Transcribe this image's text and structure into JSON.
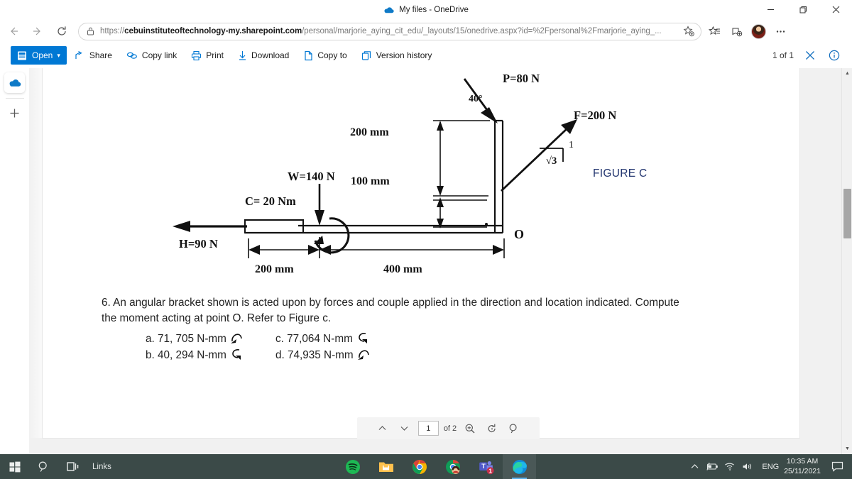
{
  "window": {
    "tab_title": "My files - OneDrive",
    "tab_icon": "onedrive-cloud-icon",
    "minimize": "–",
    "maximize": "❐",
    "close": "✕"
  },
  "navbar": {
    "back_icon": "back-arrow-icon",
    "forward_icon": "forward-arrow-icon",
    "refresh_icon": "refresh-icon",
    "lock_icon": "lock-icon",
    "url_prefix": "https://",
    "url_domain": "cebuinstituteoftechnology-my.sharepoint.com",
    "url_path": "/personal/marjorie_aying_cit_edu/_layouts/15/onedrive.aspx?id=%2Fpersonal%2Fmarjorie_aying_...",
    "favorite_icon": "add-favorite-star-icon",
    "favorites_icon": "favorites-list-icon",
    "collections_icon": "collections-icon",
    "profile_icon": "user-avatar",
    "more_icon": "more-options-ellipsis-icon"
  },
  "sidestrip": {
    "items": [
      {
        "name": "browser-essentials-icon",
        "label": ""
      },
      {
        "name": "onedrive-app-icon",
        "label": ""
      },
      {
        "name": "add-sidebar-app-icon",
        "label": "+"
      }
    ]
  },
  "toolbar": {
    "open_label": "Open",
    "open_icon": "open-file-icon",
    "open_chevron": "⌄",
    "items": [
      {
        "label": "Share",
        "icon": "share-icon"
      },
      {
        "label": "Copy link",
        "icon": "copy-link-icon"
      },
      {
        "label": "Print",
        "icon": "print-icon"
      },
      {
        "label": "Download",
        "icon": "download-icon"
      },
      {
        "label": "Copy to",
        "icon": "copy-to-icon"
      },
      {
        "label": "Version history",
        "icon": "version-history-icon"
      }
    ],
    "page_count": "1 of 1",
    "close_icon": "close-icon",
    "info_icon": "info-icon",
    "accent_color": "#0078d4"
  },
  "document": {
    "figure": {
      "label": "FIGURE C",
      "label_color": "#22356f",
      "annotations": {
        "P": "P=80 N",
        "angle": "40°",
        "F": "F=200 N",
        "W": "W=140 N",
        "C": "C= 20 Nm",
        "H": "H=90 N",
        "O": "O",
        "dim_200_vertical": "200 mm",
        "dim_100_vertical": "100 mm",
        "dim_200_horizontal": "200 mm",
        "dim_400_horizontal": "400 mm",
        "slope_rise": "1",
        "slope_run": "√3"
      }
    },
    "question": {
      "number": "6.",
      "line1": "6. An angular bracket shown is acted upon by forces and couple applied in the direction and location indicated. Compute",
      "line2": "the moment acting at point O. Refer to Figure c.",
      "choices": [
        {
          "key": "a.",
          "text": "a. 71, 705 N-mm",
          "arrow": "counterclockwise-arrow-icon"
        },
        {
          "key": "c.",
          "text": "c.  77,064 N-mm",
          "arrow": "clockwise-arrow-icon"
        },
        {
          "key": "b.",
          "text": "b. 40, 294 N-mm",
          "arrow": "clockwise-arrow-icon"
        },
        {
          "key": "d.",
          "text": "d.  74,935 N-mm",
          "arrow": "counterclockwise-arrow-icon"
        }
      ]
    }
  },
  "pdfbar": {
    "prev_icon": "chevron-up-icon",
    "next_icon": "chevron-down-icon",
    "page_value": "1",
    "page_of": "of 2",
    "zoom_in_icon": "zoom-in-icon",
    "rotate_icon": "rotate-icon",
    "search_icon": "search-icon"
  },
  "taskbar": {
    "start_icon": "windows-start-icon",
    "search_icon": "taskbar-search-icon",
    "taskview_icon": "task-view-icon",
    "links_label": "Links",
    "apps": [
      {
        "name": "spotify-icon"
      },
      {
        "name": "file-explorer-icon"
      },
      {
        "name": "chrome-icon"
      },
      {
        "name": "chrome-profile-icon"
      },
      {
        "name": "microsoft-teams-icon",
        "badge": "1"
      },
      {
        "name": "microsoft-edge-icon",
        "active": true
      }
    ],
    "tray": {
      "expand_icon": "show-hidden-icons-chevron",
      "battery_icon": "battery-icon",
      "wifi_icon": "wifi-icon",
      "volume_icon": "volume-icon",
      "language": "ENG",
      "time": "10:35 AM",
      "date": "25/11/2021",
      "notification_icon": "action-center-icon"
    },
    "background_color": "#3b4a48"
  }
}
